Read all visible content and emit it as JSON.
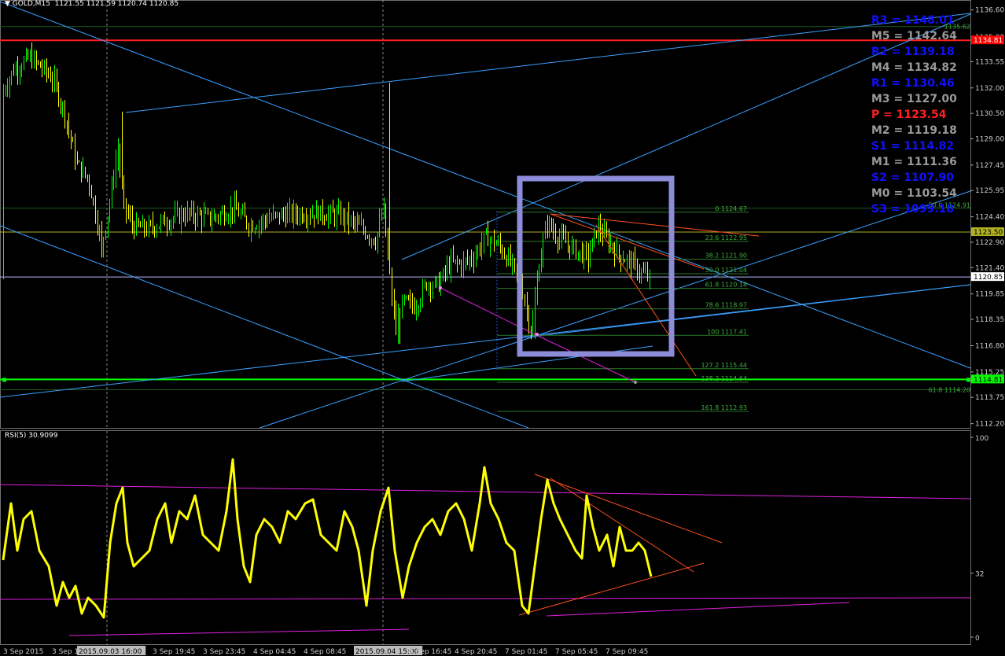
{
  "header": {
    "symbol": "GOLD,M15",
    "ohlc": "1121.55 1121.59 1120.74 1120.85"
  },
  "rsi_header": {
    "label": "RSI(5) 30.9099"
  },
  "pivots": [
    {
      "label": "R3 = 1148.01",
      "color": "#1010ff"
    },
    {
      "label": "M5 = 1142.64",
      "color": "#9a9a9a"
    },
    {
      "label": "R2 = 1139.18",
      "color": "#1010ff"
    },
    {
      "label": "M4 = 1134.82",
      "color": "#9a9a9a"
    },
    {
      "label": "R1 = 1130.46",
      "color": "#1010ff"
    },
    {
      "label": "M3 = 1127.00",
      "color": "#9a9a9a"
    },
    {
      "label": "P  = 1123.54",
      "color": "#ff2020"
    },
    {
      "label": "M2 = 1119.18",
      "color": "#9a9a9a"
    },
    {
      "label": "S1 = 1114.82",
      "color": "#1010ff"
    },
    {
      "label": "M1 = 1111.36",
      "color": "#9a9a9a"
    },
    {
      "label": "S2 = 1107.90",
      "color": "#1010ff"
    },
    {
      "label": "M0 = 1103.54",
      "color": "#9a9a9a"
    },
    {
      "label": "S3 = 1099.18",
      "color": "#1010ff"
    }
  ],
  "chart_data": [
    {
      "type": "line",
      "name": "GOLD,M15",
      "ylim": [
        1111.95,
        1137.0
      ],
      "y_ticks": [
        1136.6,
        1135.0,
        1133.55,
        1132.0,
        1130.5,
        1129.0,
        1127.45,
        1125.95,
        1124.4,
        1122.9,
        1121.4,
        1119.85,
        1118.35,
        1116.8,
        1115.25,
        1113.75,
        1112.2
      ],
      "x_ticks": [
        "3 Sep 2015",
        "3 Sep 12:45",
        "2015.09.03 16:00",
        "3 Sep 19:45",
        "3 Sep 23:45",
        "4 Sep 04:45",
        "4 Sep 08:45",
        "2015.09.04 15:00",
        "4 Sep 16:45",
        "4 Sep 20:45",
        "7 Sep 01:45",
        "7 Sep 05:45",
        "7 Sep 09:45"
      ],
      "price_tags": [
        {
          "value": 1134.81,
          "bg": "#ff0000",
          "fg": "#ffffff"
        },
        {
          "value": 1123.5,
          "bg": "#b0b020",
          "fg": "#000000"
        },
        {
          "value": 1120.85,
          "bg": "#ffffff",
          "fg": "#000000"
        },
        {
          "value": 1114.81,
          "bg": "#00ff00",
          "fg": "#000000"
        }
      ],
      "fibonacci_levels": [
        {
          "label": "0 1124.67",
          "value": 1124.67
        },
        {
          "label": "23.6 1122.95",
          "value": 1122.95
        },
        {
          "label": "38.2 1121.90",
          "value": 1121.9
        },
        {
          "label": "50.0 1121.04",
          "value": 1121.04
        },
        {
          "label": "61.8 1120.18",
          "value": 1120.18
        },
        {
          "label": "78.6 1118.97",
          "value": 1118.97
        },
        {
          "label": "100 1117.41",
          "value": 1117.41
        },
        {
          "label": "127.2 1115.44",
          "value": 1115.44
        },
        {
          "label": "138.2 1114.64",
          "value": 1114.64
        },
        {
          "label": "161.8 1112.93",
          "value": 1112.93
        }
      ],
      "other_labels": [
        {
          "label": "61.8 1114.20",
          "value": 1114.2
        },
        {
          "label": "50.0 1124.91",
          "value": 1124.91
        },
        {
          "label": "1135.62",
          "value": 1135.62
        }
      ],
      "horizontal_lines": [
        {
          "value": 1134.81,
          "color": "#ff2020"
        },
        {
          "value": 1123.5,
          "color": "#b0b020"
        },
        {
          "value": 1114.81,
          "color": "#00ff00"
        },
        {
          "value": 1120.85,
          "color": "#b8b8ff"
        }
      ],
      "colors": {
        "up_candle": "#00ff00",
        "down_candle": "#ffff00",
        "trend_lines": "#3aa0ff",
        "highlight_box": "#8c8cd8"
      }
    },
    {
      "type": "line",
      "name": "RSI(5)",
      "ylim": [
        0,
        100
      ],
      "y_ticks": [
        100,
        32,
        0
      ],
      "last_value": 30.9099,
      "colors": {
        "line": "#ffff00",
        "channel": "#e020e0",
        "triangle": "#ff5020"
      }
    }
  ]
}
